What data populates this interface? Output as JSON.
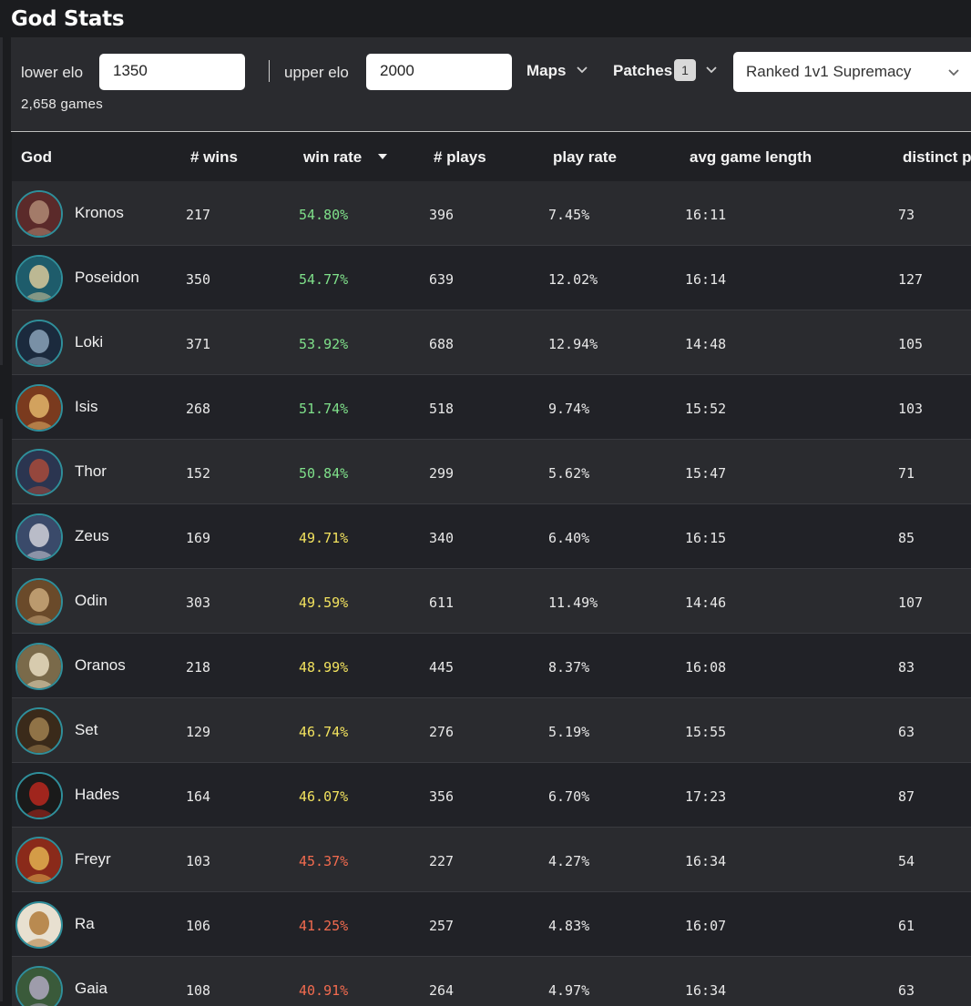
{
  "title": "God Stats",
  "filters": {
    "lower_label": "lower elo",
    "lower_value": "1350",
    "upper_label": "upper elo",
    "upper_value": "2000",
    "maps_label": "Maps",
    "patches_label": "Patches",
    "patches_count": "1",
    "mode_value": "Ranked 1v1 Supremacy",
    "games_count": "2,658 games"
  },
  "columns": [
    "God",
    "# wins",
    "win rate",
    "# plays",
    "play rate",
    "avg game length",
    "distinct p"
  ],
  "sort_column": "win rate",
  "colors": {
    "good": "#7fe08a",
    "mid": "#f2e25e",
    "bad": "#f26b4f",
    "avatar_ring": "#2f8f9b"
  },
  "rows": [
    {
      "god": "Kronos",
      "wins": "217",
      "win_rate": "54.80%",
      "plays": "396",
      "play_rate": "7.45%",
      "avg_length": "16:11",
      "distinct": "73",
      "tier": "good",
      "avatar_colors": [
        "#5b2a2a",
        "#b08a74"
      ]
    },
    {
      "god": "Poseidon",
      "wins": "350",
      "win_rate": "54.77%",
      "plays": "639",
      "play_rate": "12.02%",
      "avg_length": "16:14",
      "distinct": "127",
      "tier": "good",
      "avatar_colors": [
        "#1e5c6b",
        "#d8c89a"
      ]
    },
    {
      "god": "Loki",
      "wins": "371",
      "win_rate": "53.92%",
      "plays": "688",
      "play_rate": "12.94%",
      "avg_length": "14:48",
      "distinct": "105",
      "tier": "good",
      "avatar_colors": [
        "#1b2a3d",
        "#8aa2b8"
      ]
    },
    {
      "god": "Isis",
      "wins": "268",
      "win_rate": "51.74%",
      "plays": "518",
      "play_rate": "9.74%",
      "avg_length": "15:52",
      "distinct": "103",
      "tier": "good",
      "avatar_colors": [
        "#7a3a1e",
        "#e2b56a"
      ]
    },
    {
      "god": "Thor",
      "wins": "152",
      "win_rate": "50.84%",
      "plays": "299",
      "play_rate": "5.62%",
      "avg_length": "15:47",
      "distinct": "71",
      "tier": "good",
      "avatar_colors": [
        "#2b3550",
        "#a84a3a"
      ]
    },
    {
      "god": "Zeus",
      "wins": "169",
      "win_rate": "49.71%",
      "plays": "340",
      "play_rate": "6.40%",
      "avg_length": "16:15",
      "distinct": "85",
      "tier": "mid",
      "avatar_colors": [
        "#3a4a6a",
        "#d0d0d8"
      ]
    },
    {
      "god": "Odin",
      "wins": "303",
      "win_rate": "49.59%",
      "plays": "611",
      "play_rate": "11.49%",
      "avg_length": "14:46",
      "distinct": "107",
      "tier": "mid",
      "avatar_colors": [
        "#6a4a2a",
        "#c9a87a"
      ]
    },
    {
      "god": "Oranos",
      "wins": "218",
      "win_rate": "48.99%",
      "plays": "445",
      "play_rate": "8.37%",
      "avg_length": "16:08",
      "distinct": "83",
      "tier": "mid",
      "avatar_colors": [
        "#7a6a4a",
        "#e8dcc0"
      ]
    },
    {
      "god": "Set",
      "wins": "129",
      "win_rate": "46.74%",
      "plays": "276",
      "play_rate": "5.19%",
      "avg_length": "15:55",
      "distinct": "63",
      "tier": "mid",
      "avatar_colors": [
        "#3a2a1a",
        "#a08050"
      ]
    },
    {
      "god": "Hades",
      "wins": "164",
      "win_rate": "46.07%",
      "plays": "356",
      "play_rate": "6.70%",
      "avg_length": "17:23",
      "distinct": "87",
      "tier": "mid",
      "avatar_colors": [
        "#1a1a1a",
        "#b8281e"
      ]
    },
    {
      "god": "Freyr",
      "wins": "103",
      "win_rate": "45.37%",
      "plays": "227",
      "play_rate": "4.27%",
      "avg_length": "16:34",
      "distinct": "54",
      "tier": "bad",
      "avatar_colors": [
        "#8a2a1a",
        "#e0b050"
      ]
    },
    {
      "god": "Ra",
      "wins": "106",
      "win_rate": "41.25%",
      "plays": "257",
      "play_rate": "4.83%",
      "avg_length": "16:07",
      "distinct": "61",
      "tier": "bad",
      "avatar_colors": [
        "#e8e0d0",
        "#b07a3a"
      ]
    },
    {
      "god": "Gaia",
      "wins": "108",
      "win_rate": "40.91%",
      "plays": "264",
      "play_rate": "4.97%",
      "avg_length": "16:34",
      "distinct": "63",
      "tier": "bad",
      "avatar_colors": [
        "#3a5a3a",
        "#b0a8c0"
      ]
    }
  ]
}
